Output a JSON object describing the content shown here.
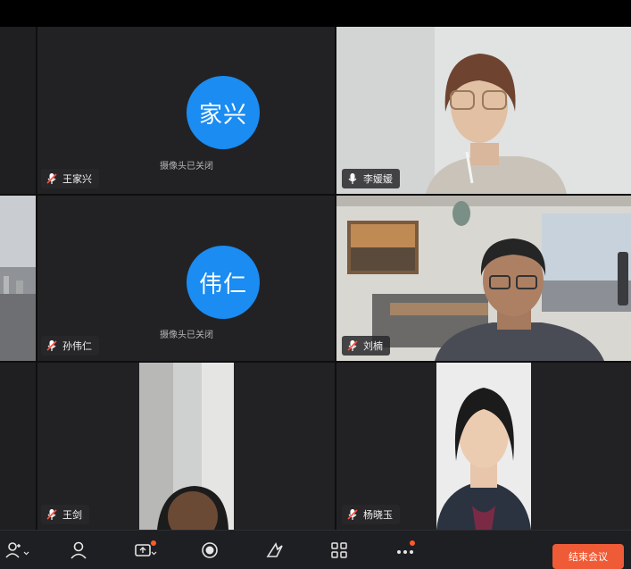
{
  "participants": {
    "p1": {
      "name": "王家兴",
      "avatar_text": "家兴",
      "status": "摄像头已关闭",
      "muted": true
    },
    "p2": {
      "name": "李媛媛",
      "muted": false
    },
    "p3": {
      "name": "孙伟仁",
      "avatar_text": "伟仁",
      "status": "摄像头已关闭",
      "muted": true
    },
    "p4": {
      "name": "刘楠",
      "muted": true
    },
    "p5": {
      "name": "王剑",
      "muted": true
    },
    "p6": {
      "name": "杨晓玉",
      "muted": true
    }
  },
  "toolbar": {
    "end_label": "结束会议",
    "items": [
      "invite-icon",
      "participants-icon",
      "share-screen-icon",
      "record-icon",
      "reactions-icon",
      "layout-icon",
      "more-icon"
    ]
  },
  "colors": {
    "avatar": "#1a8cf2",
    "end_button": "#ef5b37",
    "notification_dot": "#ff5a2a",
    "background": "#222225"
  }
}
